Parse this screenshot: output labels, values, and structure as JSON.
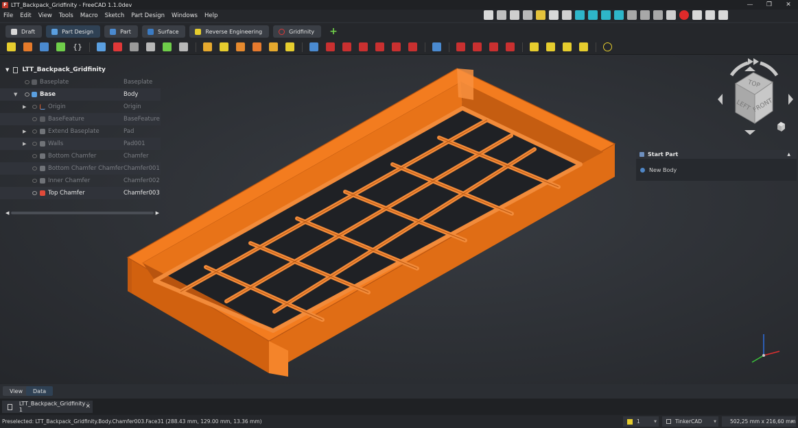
{
  "window": {
    "title": "LTT_Backpack_Gridfinity - FreeCAD 1.1.0dev",
    "minimize": "—",
    "maximize": "❐",
    "close": "✕"
  },
  "menu": [
    "File",
    "Edit",
    "View",
    "Tools",
    "Macro",
    "Sketch",
    "Part Design",
    "Windows",
    "Help"
  ],
  "workbenches": [
    "Draft",
    "Part Design",
    "Part",
    "Surface",
    "Reverse Engineering",
    "Gridfinity"
  ],
  "workbench_add": "+",
  "tree": {
    "root": "LTT_Backpack_Gridfinity",
    "rows": [
      {
        "label": "Baseplate",
        "type": "Baseplate"
      },
      {
        "label": "Base",
        "type": "Body"
      },
      {
        "label": "Origin",
        "type": "Origin"
      },
      {
        "label": "BaseFeature",
        "type": "BaseFeature"
      },
      {
        "label": "Extend Baseplate",
        "type": "Pad"
      },
      {
        "label": "Walls",
        "type": "Pad001"
      },
      {
        "label": "Bottom Chamfer",
        "type": "Chamfer"
      },
      {
        "label": "Bottom Chamfer Chamfer",
        "type": "Chamfer001"
      },
      {
        "label": "Inner Chamfer",
        "type": "Chamfer002"
      },
      {
        "label": "Top Chamfer",
        "type": "Chamfer003"
      }
    ]
  },
  "task_panel": {
    "header": "Start Part",
    "action": "New Body"
  },
  "navcube": {
    "top": "TOP",
    "left": "LEFT",
    "front": "FRONT"
  },
  "bottom_tabs": {
    "view": "View",
    "data": "Data"
  },
  "document_tab": "LTT_Backpack_Gridfinity : 1",
  "status": {
    "message": "Preselected: LTT_Backpack_Gridfinity.Body.Chamfer003.Face31 (288.43 mm, 129.00 mm, 13.36 mm)",
    "layer": "1",
    "navigation": "TinkerCAD",
    "dimensions": "502,25 mm x 216,60 mm"
  },
  "colors": {
    "model": "#f07a1f",
    "model_dark": "#c9580f",
    "background": "#2b2e33"
  }
}
